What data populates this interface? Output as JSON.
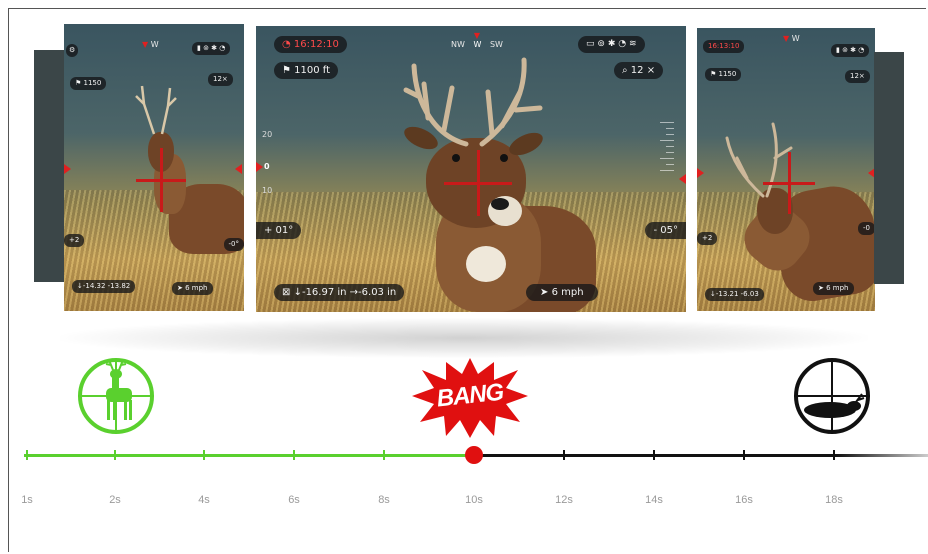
{
  "colors": {
    "green": "#5ad02e",
    "red": "#e01010",
    "dark": "#111111",
    "reticle": "#c81a1a",
    "time_red": "#ff4a4a"
  },
  "main_view": {
    "time": "16:12:10",
    "compass": [
      "NW",
      "W",
      "SW"
    ],
    "range": "1100 ft",
    "zoom": "12 ×",
    "angle_left": "+ 01°",
    "angle_right": "- 05°",
    "scale_marks": [
      "20",
      "0",
      "10"
    ],
    "offsets": "↓-16.97 in   →-6.03 in",
    "wind": "6 mph",
    "status_icons": [
      "battery-icon",
      "gps-icon",
      "bluetooth-icon",
      "compass-icon",
      "wifi-icon"
    ]
  },
  "left_view": {
    "range": "1150",
    "zoom": "12×",
    "angle_left": "+2",
    "angle_right": "-0°",
    "offsets": "↓-14.32 -13.82",
    "wind": "6 mph",
    "compass": [
      "W"
    ]
  },
  "right_view": {
    "time": "16:13:10",
    "range": "1150",
    "zoom": "12×",
    "angle_left": "+2",
    "angle_right": "-0",
    "offsets": "↓-13.21 -6.03",
    "wind": "6 mph",
    "compass": [
      "W"
    ]
  },
  "events": {
    "bang_label": "BANG",
    "start_icon": "deer-in-scope-icon",
    "end_icon": "downed-deer-scope-icon"
  },
  "timeline": {
    "ticks": [
      "1s",
      "2s",
      "4s",
      "6s",
      "8s",
      "10s",
      "12s",
      "14s",
      "16s",
      "18s"
    ],
    "current_index": 5
  }
}
